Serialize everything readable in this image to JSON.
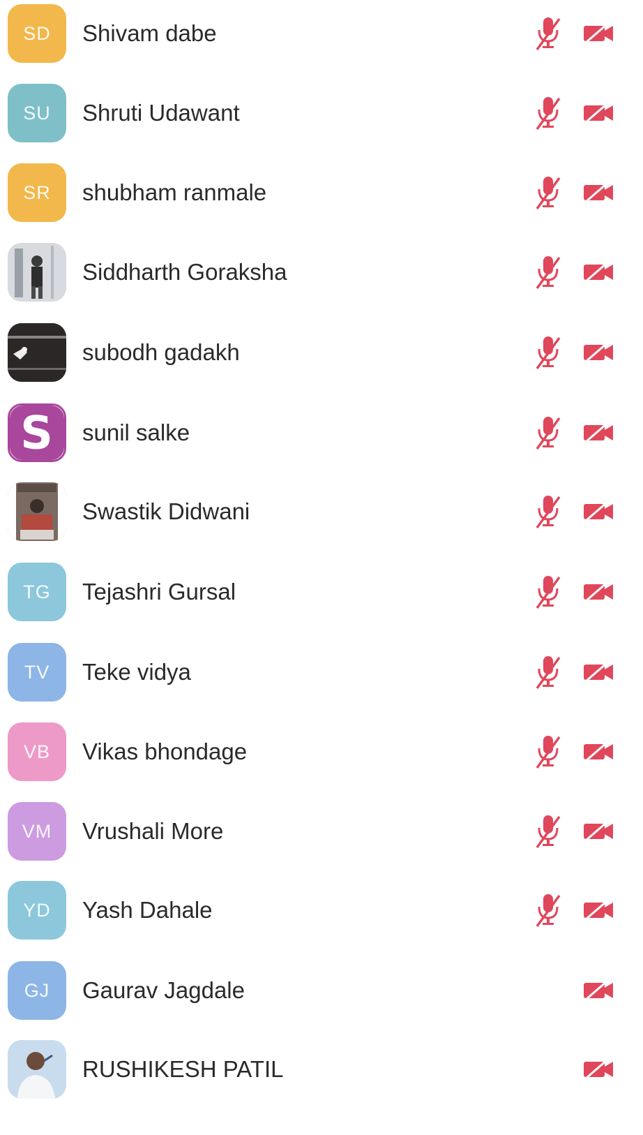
{
  "participants": [
    {
      "initials": "SD",
      "name": "Shivam dabe",
      "avatar_color": "#F2B84B",
      "avatar_type": "initials",
      "mic_muted": true,
      "video_off": true
    },
    {
      "initials": "SU",
      "name": "Shruti Udawant",
      "avatar_color": "#7FBFC8",
      "avatar_type": "initials",
      "mic_muted": true,
      "video_off": true
    },
    {
      "initials": "SR",
      "name": "shubham ranmale",
      "avatar_color": "#F2B84B",
      "avatar_type": "initials",
      "mic_muted": true,
      "video_off": true
    },
    {
      "initials": "",
      "name": "Siddharth Goraksha",
      "avatar_color": "#C9CCD2",
      "avatar_type": "photo",
      "mic_muted": true,
      "video_off": true
    },
    {
      "initials": "",
      "name": "subodh gadakh",
      "avatar_color": "#2E2A2A",
      "avatar_type": "photo",
      "mic_muted": true,
      "video_off": true
    },
    {
      "initials": "S",
      "name": "sunil salke",
      "avatar_color": "#A8479B",
      "avatar_type": "logo",
      "mic_muted": true,
      "video_off": true
    },
    {
      "initials": "",
      "name": "Swastik Didwani",
      "avatar_color": "#8A7A70",
      "avatar_type": "photo",
      "mic_muted": true,
      "video_off": true
    },
    {
      "initials": "TG",
      "name": "Tejashri Gursal",
      "avatar_color": "#8CC7DC",
      "avatar_type": "initials",
      "mic_muted": true,
      "video_off": true
    },
    {
      "initials": "TV",
      "name": "Teke vidya",
      "avatar_color": "#8DB5E6",
      "avatar_type": "initials",
      "mic_muted": true,
      "video_off": true
    },
    {
      "initials": "VB",
      "name": "Vikas bhondage",
      "avatar_color": "#EE9AC8",
      "avatar_type": "initials",
      "mic_muted": true,
      "video_off": true
    },
    {
      "initials": "VM",
      "name": "Vrushali More",
      "avatar_color": "#CD9BE0",
      "avatar_type": "initials",
      "mic_muted": true,
      "video_off": true
    },
    {
      "initials": "YD",
      "name": "Yash Dahale",
      "avatar_color": "#8CC7DC",
      "avatar_type": "initials",
      "mic_muted": true,
      "video_off": true
    },
    {
      "initials": "GJ",
      "name": "Gaurav Jagdale",
      "avatar_color": "#8DB5E6",
      "avatar_type": "initials",
      "mic_muted": false,
      "video_off": true
    },
    {
      "initials": "",
      "name": "RUSHIKESH PATIL",
      "avatar_color": "#B7CFE6",
      "avatar_type": "photo",
      "mic_muted": false,
      "video_off": true
    }
  ],
  "colors": {
    "muted_icon": "#E0475B",
    "name_text": "#2A2A2A"
  },
  "icons": {
    "mic": "mic-off-icon",
    "cam": "video-off-icon"
  }
}
